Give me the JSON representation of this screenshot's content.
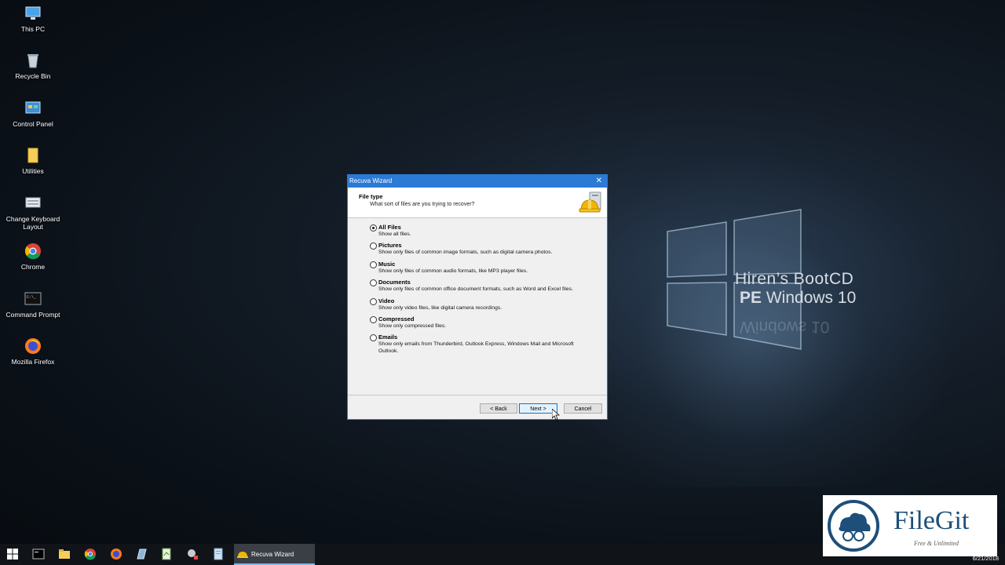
{
  "desktop": {
    "icons": [
      {
        "label": "This PC",
        "icon": "this-pc-icon"
      },
      {
        "label": "Recycle Bin",
        "icon": "recycle-bin-icon"
      },
      {
        "label": "Control Panel",
        "icon": "control-panel-icon"
      },
      {
        "label": "Utilities",
        "icon": "folder-icon"
      },
      {
        "label": "Change Keyboard Layout",
        "icon": "keyboard-icon"
      },
      {
        "label": "Chrome",
        "icon": "chrome-icon"
      },
      {
        "label": "Command Prompt",
        "icon": "cmd-icon"
      },
      {
        "label": "Mozilla Firefox",
        "icon": "firefox-icon"
      }
    ],
    "brand_line1": "Hiren’s BootCD",
    "brand_line2_bold": "PE",
    "brand_line2": "Windows 10",
    "brand_reflection": "Windows 10"
  },
  "dialog": {
    "title": "Recuva Wizard",
    "close": "✕",
    "header_title": "File type",
    "header_subtitle": "What sort of files are you trying to recover?",
    "selected": "All Files",
    "options": [
      {
        "label": "All Files",
        "desc": "Show all files."
      },
      {
        "label": "Pictures",
        "desc": "Show only files of common image formats, such as digital camera photos."
      },
      {
        "label": "Music",
        "desc": "Show only files of common audio formats, like MP3 player files."
      },
      {
        "label": "Documents",
        "desc": "Show only files of common office document formats, such as Word and Excel files."
      },
      {
        "label": "Video",
        "desc": "Show only video files, like digital camera recordings."
      },
      {
        "label": "Compressed",
        "desc": "Show only compressed files."
      },
      {
        "label": "Emails",
        "desc": "Show only emails from Thunderbird, Outlook Express, Windows Mail and Microsoft Outlook."
      }
    ],
    "buttons": {
      "back": "< Back",
      "next": "Next >",
      "cancel": "Cancel"
    }
  },
  "taskbar": {
    "active_window": "Recuva Wizard",
    "clock": "6/21/2018",
    "pinned": [
      "start-icon",
      "cmd-icon",
      "explorer-icon",
      "chrome-icon",
      "firefox-icon",
      "app-icon",
      "notepad-icon",
      "tool-icon",
      "document-icon"
    ]
  },
  "watermark": {
    "name": "FileGit",
    "tagline": "Free & Unlimited"
  },
  "colors": {
    "accent": "#2b7ad6",
    "taskbar": "#101419"
  }
}
